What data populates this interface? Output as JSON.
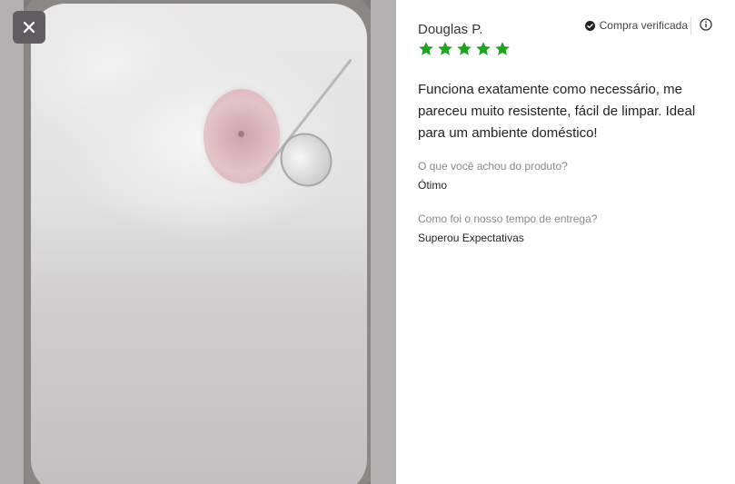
{
  "colors": {
    "star": "#1da51d",
    "verified_icon": "#222222",
    "close_bg": "#5f5d5f"
  },
  "photo": {
    "icon": "close-icon"
  },
  "review": {
    "author": "Douglas P.",
    "verified_label": "Compra verificada",
    "rating": 5,
    "rating_max": 5,
    "text": "Funciona exatamente como necessário, me pareceu muito resistente, fácil de limpar. Ideal para um ambiente doméstico!",
    "questions": [
      {
        "label": "O que você achou do produto?",
        "answer": "Ótimo"
      },
      {
        "label": "Como foi o nosso tempo de entrega?",
        "answer": "Superou Expectativas"
      }
    ]
  }
}
